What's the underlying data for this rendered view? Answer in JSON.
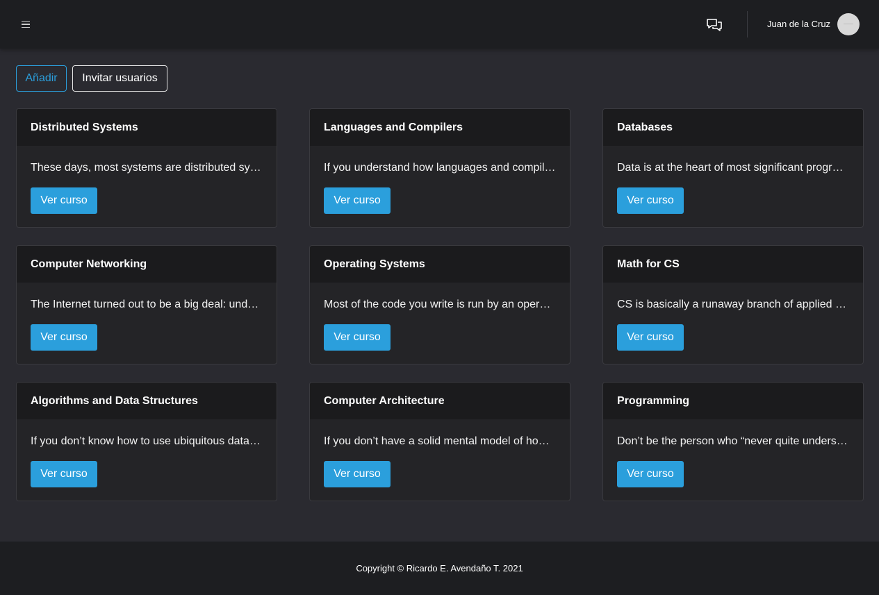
{
  "header": {
    "menu_icon": "hamburger-menu-icon",
    "chat_icon": "chat-bubbles-icon",
    "user_name": "Juan de la Cruz"
  },
  "actions": {
    "add_label": "Añadir",
    "invite_label": "Invitar usuarios"
  },
  "courses": [
    {
      "title": "Distributed Systems",
      "description": "These days, most systems are distributed systems",
      "button": "Ver curso"
    },
    {
      "title": "Languages and Compilers",
      "description": "If you understand how languages and compilers actually work",
      "button": "Ver curso"
    },
    {
      "title": "Databases",
      "description": "Data is at the heart of most significant programs",
      "button": "Ver curso"
    },
    {
      "title": "Computer Networking",
      "description": "The Internet turned out to be a big deal: understand how it works",
      "button": "Ver curso"
    },
    {
      "title": "Operating Systems",
      "description": "Most of the code you write is run by an operating system",
      "button": "Ver curso"
    },
    {
      "title": "Math for CS",
      "description": "CS is basically a runaway branch of applied math",
      "button": "Ver curso"
    },
    {
      "title": "Algorithms and Data Structures",
      "description": "If you don’t know how to use ubiquitous data structures",
      "button": "Ver curso"
    },
    {
      "title": "Computer Architecture",
      "description": "If you don’t have a solid mental model of how a computer works",
      "button": "Ver curso"
    },
    {
      "title": "Programming",
      "description": "Don’t be the person who “never quite understood” something",
      "button": "Ver curso"
    }
  ],
  "footer": {
    "copyright": "Copyright © Ricardo E. Avendaño T. 2021"
  },
  "colors": {
    "accent": "#2b9fdc",
    "topbar": "#1d1e21",
    "background": "#2a2a30",
    "card": "#242427",
    "card_header": "#1b1b1d"
  }
}
